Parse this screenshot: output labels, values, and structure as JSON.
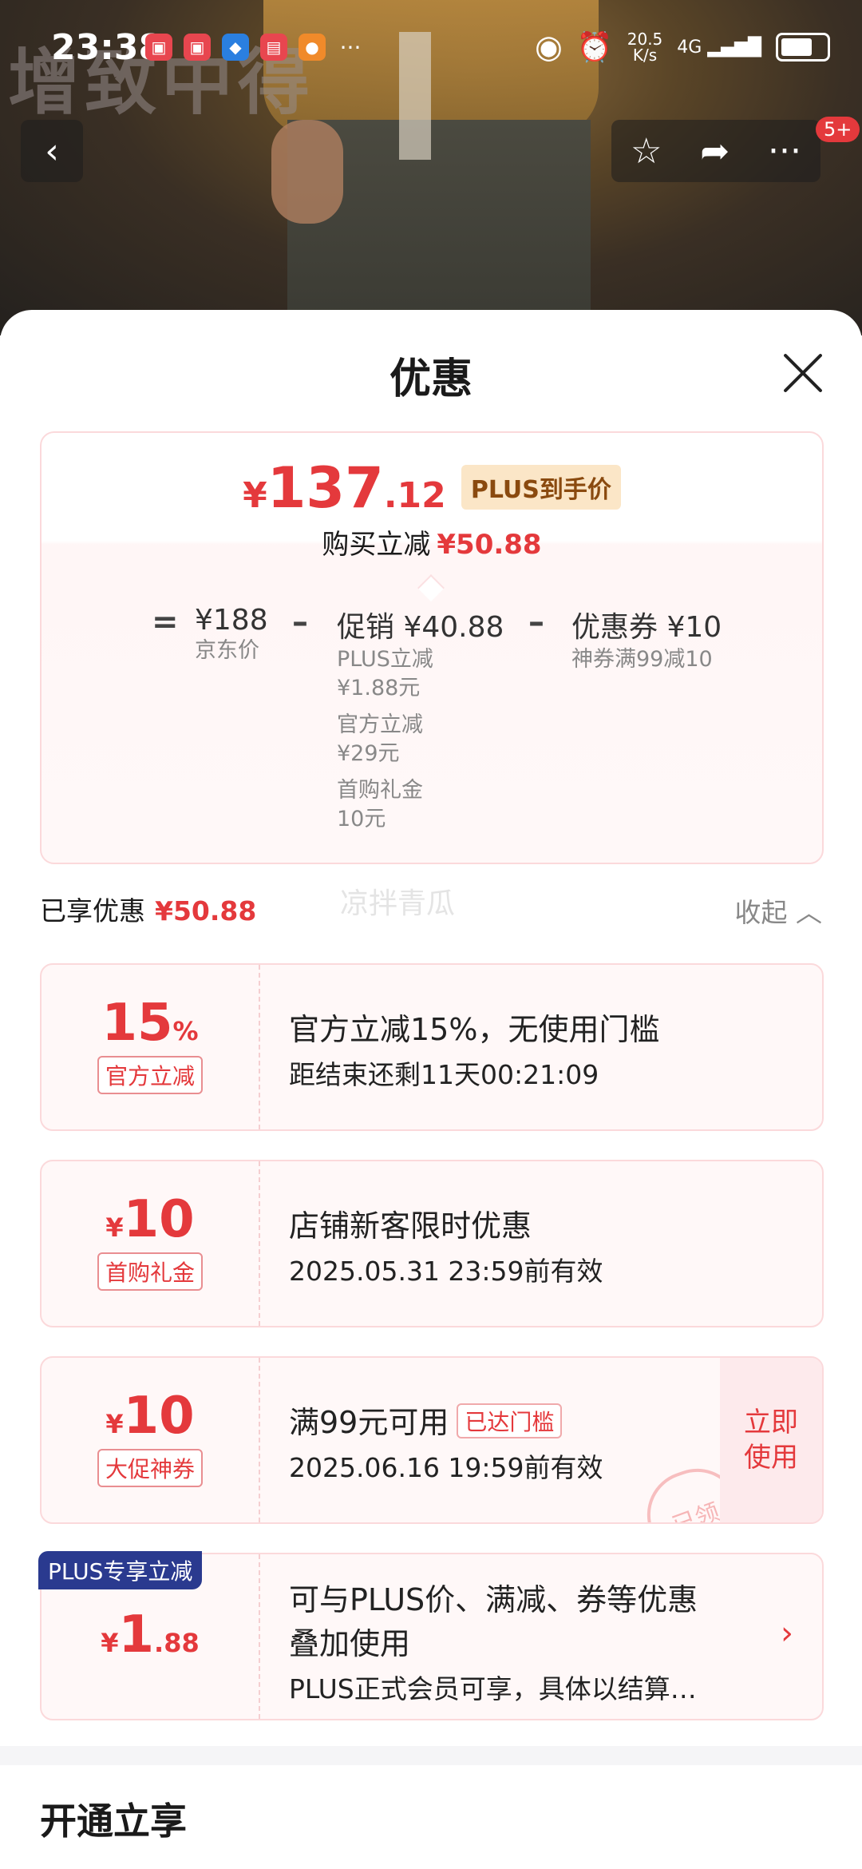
{
  "status": {
    "time": "23:38",
    "speed_top": "20.5",
    "speed_bottom": "K/s",
    "network": "4G"
  },
  "background": {
    "watermark": "增致中得"
  },
  "header": {
    "badge": "5+"
  },
  "sheet": {
    "title": "优惠"
  },
  "price": {
    "currency": "¥",
    "integer": "137",
    "decimal": ".12",
    "plus_tag": "PLUS到手价",
    "reduce_label": "购买立减",
    "reduce_value": "¥50.88",
    "equals": "=",
    "jd_price": "¥188",
    "jd_label": "京东价",
    "minus": "–",
    "promo": "促销 ¥40.88",
    "promo_items": [
      "PLUS立减",
      "¥1.88元",
      "官方立减",
      "¥29元",
      "首购礼金",
      "10元"
    ],
    "coupon": "优惠券 ¥10",
    "coupon_desc": "神券满99减10"
  },
  "enjoyed": {
    "label": "已享优惠",
    "value": "¥50.88",
    "watermark": "凉拌青瓜",
    "collapse": "收起"
  },
  "cards": [
    {
      "amount": "15",
      "suffix": "%",
      "tag": "官方立减",
      "title": "官方立减15%，无使用门槛",
      "desc": "距结束还剩11天00:21:09"
    },
    {
      "prefix": "¥",
      "amount": "10",
      "tag": "首购礼金",
      "title": "店铺新客限时优惠",
      "desc": "2025.05.31 23:59前有效"
    },
    {
      "prefix": "¥",
      "amount": "10",
      "tag": "大促神券",
      "title": "满99元可用",
      "reached": "已达门槛",
      "desc": "2025.06.16 19:59前有效",
      "use": "立即使用",
      "stamp": "已领"
    },
    {
      "corner": "PLUS专享立减",
      "prefix": "¥",
      "amount": "1",
      "decimal": ".88",
      "title": "可与PLUS价、满减、券等优惠",
      "title2": "叠加使用",
      "desc": "PLUS正式会员可享，具体以结算…"
    }
  ],
  "open_section": {
    "title": "开通立享"
  }
}
